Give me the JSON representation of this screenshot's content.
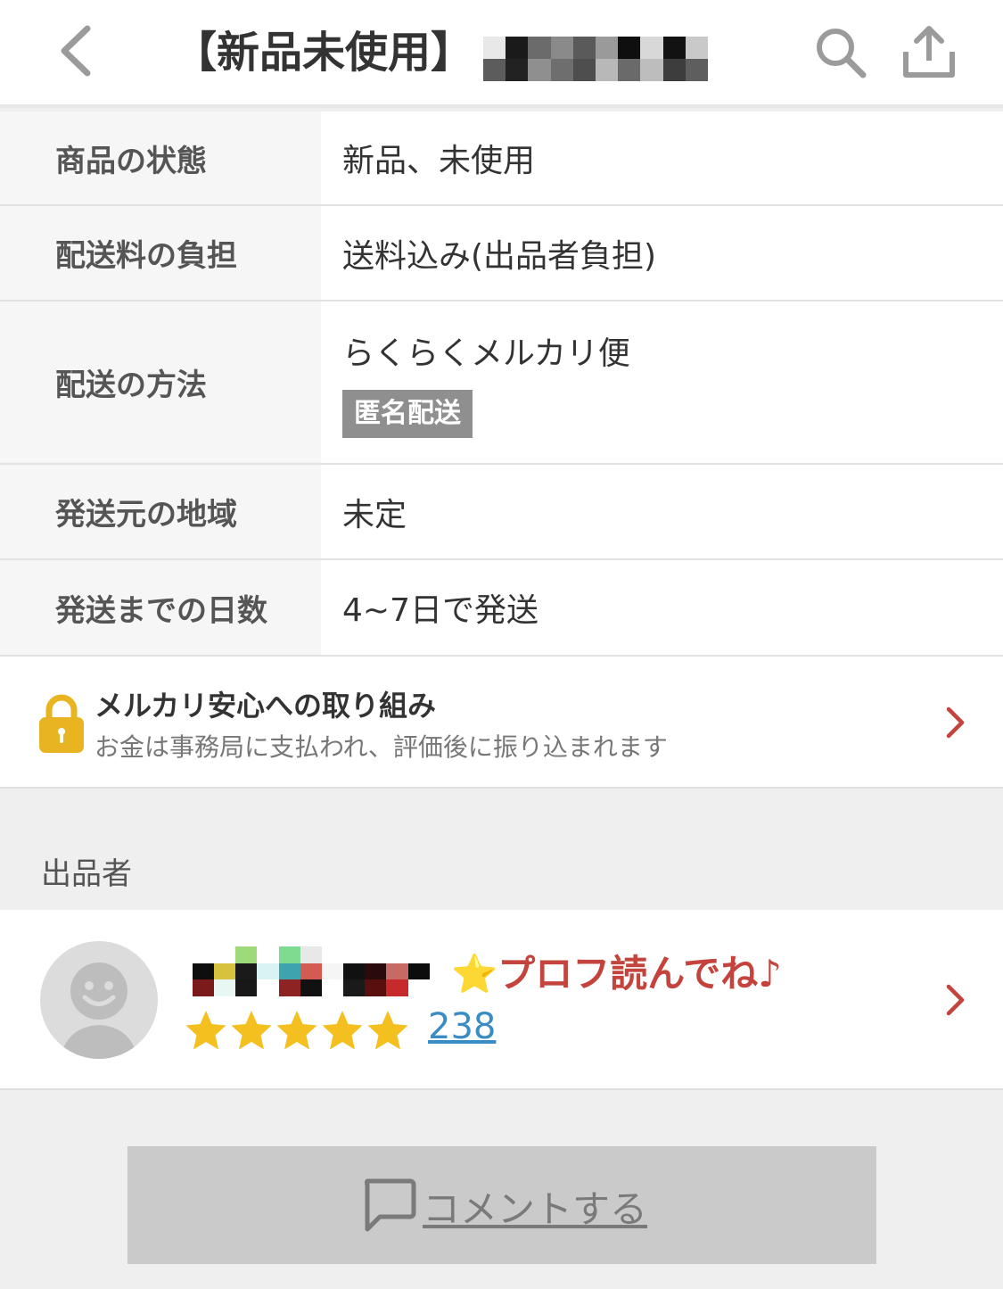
{
  "header": {
    "title": "【新品未使用】"
  },
  "details": [
    {
      "label": "商品の状態",
      "value": "新品、未使用"
    },
    {
      "label": "配送料の負担",
      "value": "送料込み(出品者負担)"
    },
    {
      "label": "配送の方法",
      "value": "らくらくメルカリ便",
      "badge": "匿名配送"
    },
    {
      "label": "発送元の地域",
      "value": "未定"
    },
    {
      "label": "発送までの日数",
      "value": "4~7日で発送"
    }
  ],
  "safety": {
    "title": "メルカリ安心への取り組み",
    "subtitle": "お金は事務局に支払われ、評価後に振り込まれます"
  },
  "seller_section": {
    "label": "出品者"
  },
  "seller": {
    "star_emoji": "⭐",
    "tagline": "プロフ読んでね♪",
    "rating_stars": 5,
    "rating_count": "238"
  },
  "comment": {
    "label": "コメントする"
  },
  "colors": {
    "accent_red": "#c4443d",
    "star_yellow": "#f4c020",
    "link_blue": "#3a8cc4",
    "badge_gray": "#8f8f8f"
  },
  "icons": [
    "back-chevron-icon",
    "search-icon",
    "share-icon",
    "lock-icon",
    "chevron-right-icon",
    "avatar-smiley-icon",
    "star-icon",
    "comment-bubble-icon"
  ]
}
